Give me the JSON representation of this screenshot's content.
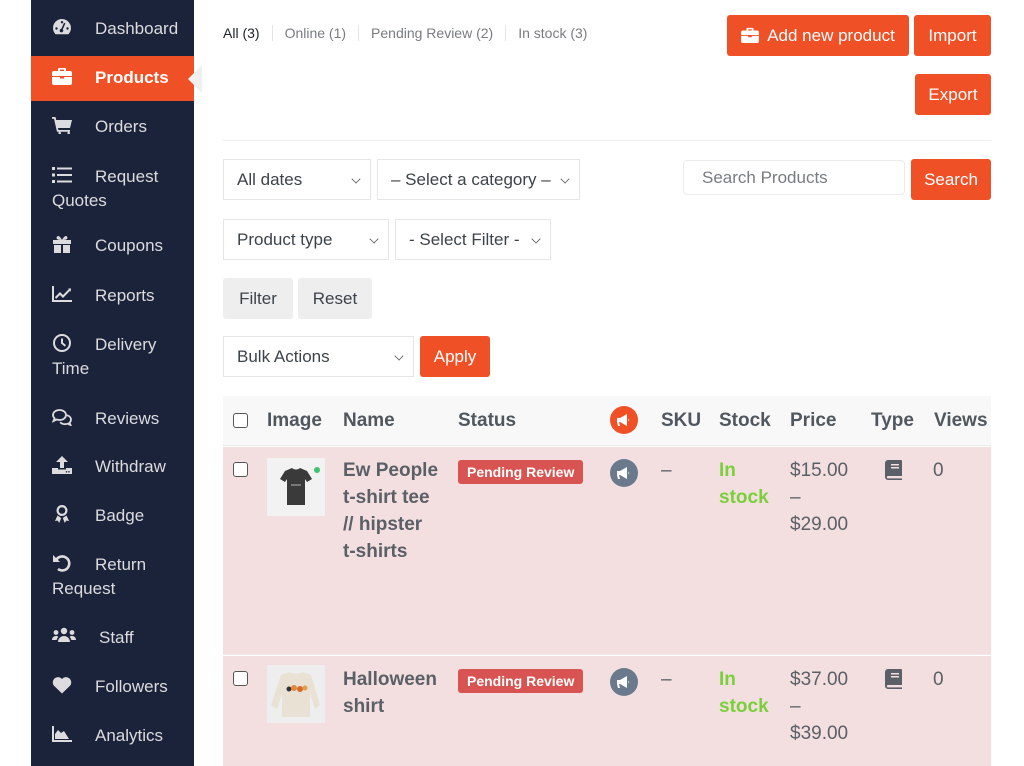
{
  "sidebar": {
    "items": [
      {
        "label": "Dashboard",
        "icon": "dashboard-icon",
        "active": false
      },
      {
        "label": "Products",
        "icon": "briefcase-icon",
        "active": true
      },
      {
        "label": "Orders",
        "icon": "cart-icon",
        "active": false
      },
      {
        "label": "Request",
        "label2": "Quotes",
        "icon": "list-icon",
        "active": false
      },
      {
        "label": "Coupons",
        "icon": "gift-icon",
        "active": false
      },
      {
        "label": "Reports",
        "icon": "chart-line-icon",
        "active": false
      },
      {
        "label": "Delivery",
        "label2": "Time",
        "icon": "clock-icon",
        "active": false
      },
      {
        "label": "Reviews",
        "icon": "comments-icon",
        "active": false
      },
      {
        "label": "Withdraw",
        "icon": "upload-icon",
        "active": false
      },
      {
        "label": "Badge",
        "icon": "award-icon",
        "active": false
      },
      {
        "label": "Return",
        "label2": "Request",
        "icon": "undo-icon",
        "active": false
      },
      {
        "label": "Staff",
        "icon": "users-icon",
        "active": false
      },
      {
        "label": "Followers",
        "icon": "heart-icon",
        "active": false
      },
      {
        "label": "Analytics",
        "icon": "area-chart-icon",
        "active": false
      }
    ]
  },
  "filters_tabs": [
    {
      "label": "All (3)",
      "current": true
    },
    {
      "label": "Online (1)",
      "current": false
    },
    {
      "label": "Pending Review (2)",
      "current": false
    },
    {
      "label": "In stock (3)",
      "current": false
    }
  ],
  "toolbar": {
    "add_new_label": "Add new product",
    "import_label": "Import",
    "export_label": "Export"
  },
  "filters": {
    "dates_value": "All dates",
    "category_value": "– Select a category –",
    "product_type_value": "Product type",
    "select_filter_value": "- Select Filter -",
    "search_placeholder": "Search Products",
    "search_label": "Search",
    "filter_label": "Filter",
    "reset_label": "Reset",
    "bulk_actions_value": "Bulk Actions",
    "apply_label": "Apply"
  },
  "table": {
    "headers": {
      "image": "Image",
      "name": "Name",
      "status": "Status",
      "sku": "SKU",
      "stock": "Stock",
      "price": "Price",
      "type": "Type",
      "views": "Views"
    },
    "rows": [
      {
        "name_lines": [
          "Ew People",
          "t-shirt tee",
          "// hipster",
          "t-shirts"
        ],
        "status": "Pending Review",
        "sku": "–",
        "stock_lines": [
          "In",
          "stock"
        ],
        "price_lines": [
          "$15.00",
          "–",
          "$29.00"
        ],
        "type_icon": "book-icon",
        "views": "0",
        "image": "black-tshirt-thumbnail"
      },
      {
        "name_lines": [
          "Halloween",
          "shirt"
        ],
        "status": "Pending Review",
        "sku": "–",
        "stock_lines": [
          "In",
          "stock"
        ],
        "price_lines": [
          "$37.00",
          "–",
          "$39.00"
        ],
        "type_icon": "book-icon",
        "views": "0",
        "image": "halloween-sweatshirt-thumbnail"
      }
    ]
  },
  "colors": {
    "accent": "#f05025",
    "sidebar_bg": "#1b233b",
    "row_bg": "#f3dfdf",
    "badge_bg": "#d85452",
    "stock_green": "#7ad03a",
    "megaphone_grey": "#6a7a8c"
  }
}
